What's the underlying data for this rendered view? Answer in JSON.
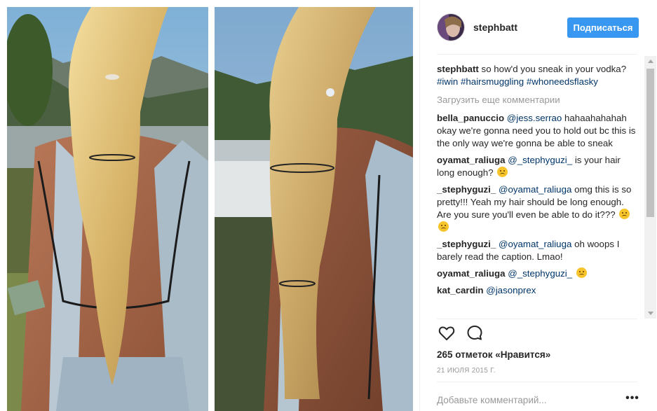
{
  "post": {
    "author": "stephbatt",
    "follow_label": "Подписаться",
    "caption": {
      "user": "stephbatt",
      "text": "so how'd you sneak in your vodka?",
      "hashtags": [
        "#iwin",
        "#hairsmuggling",
        "#whoneedsflasky"
      ]
    },
    "load_more_label": "Загрузить еще комментарии",
    "comments": [
      {
        "user": "bella_panuccio",
        "mention": "@jess.serrao",
        "text": "hahaahahahah okay we're gonna need you to hold out bc this is the only way we're gonna be able to sneak",
        "emoji": []
      },
      {
        "user": "oyamat_raliuga",
        "mention": "@_stephyguzi_",
        "text": "is your hair long enough?",
        "emoji": [
          "tired-face-emoji"
        ]
      },
      {
        "user": "_stephyguzi_",
        "mention": "@oyamat_raliuga",
        "text": "omg this is so pretty!!! Yeah my hair should be long enough. Are you sure you'll even be able to do it???",
        "emoji": [
          "sweat-smile-emoji",
          "crying-laughing-emoji"
        ]
      },
      {
        "user": "_stephyguzi_",
        "mention": "@oyamat_raliuga",
        "text": "oh woops I barely read the caption. Lmao!",
        "emoji": []
      },
      {
        "user": "oyamat_raliuga",
        "mention": "@_stephyguzi_",
        "text": "",
        "emoji": [
          "crying-laughing-emoji"
        ]
      },
      {
        "user": "kat_cardin",
        "mention": "@jasonprex",
        "text": "",
        "emoji": []
      }
    ],
    "likes_label": "265 отметок «Нравится»",
    "date_label": "21 ИЮЛЯ 2015 Г.",
    "add_comment_placeholder": "Добавьте комментарий...",
    "more_label": "•••"
  },
  "icons": {
    "heart": "heart-icon",
    "comment": "comment-bubble-icon",
    "more": "more-options-icon"
  },
  "colors": {
    "follow_button": "#3897f0",
    "hashtag": "#003569",
    "muted": "#999999"
  }
}
